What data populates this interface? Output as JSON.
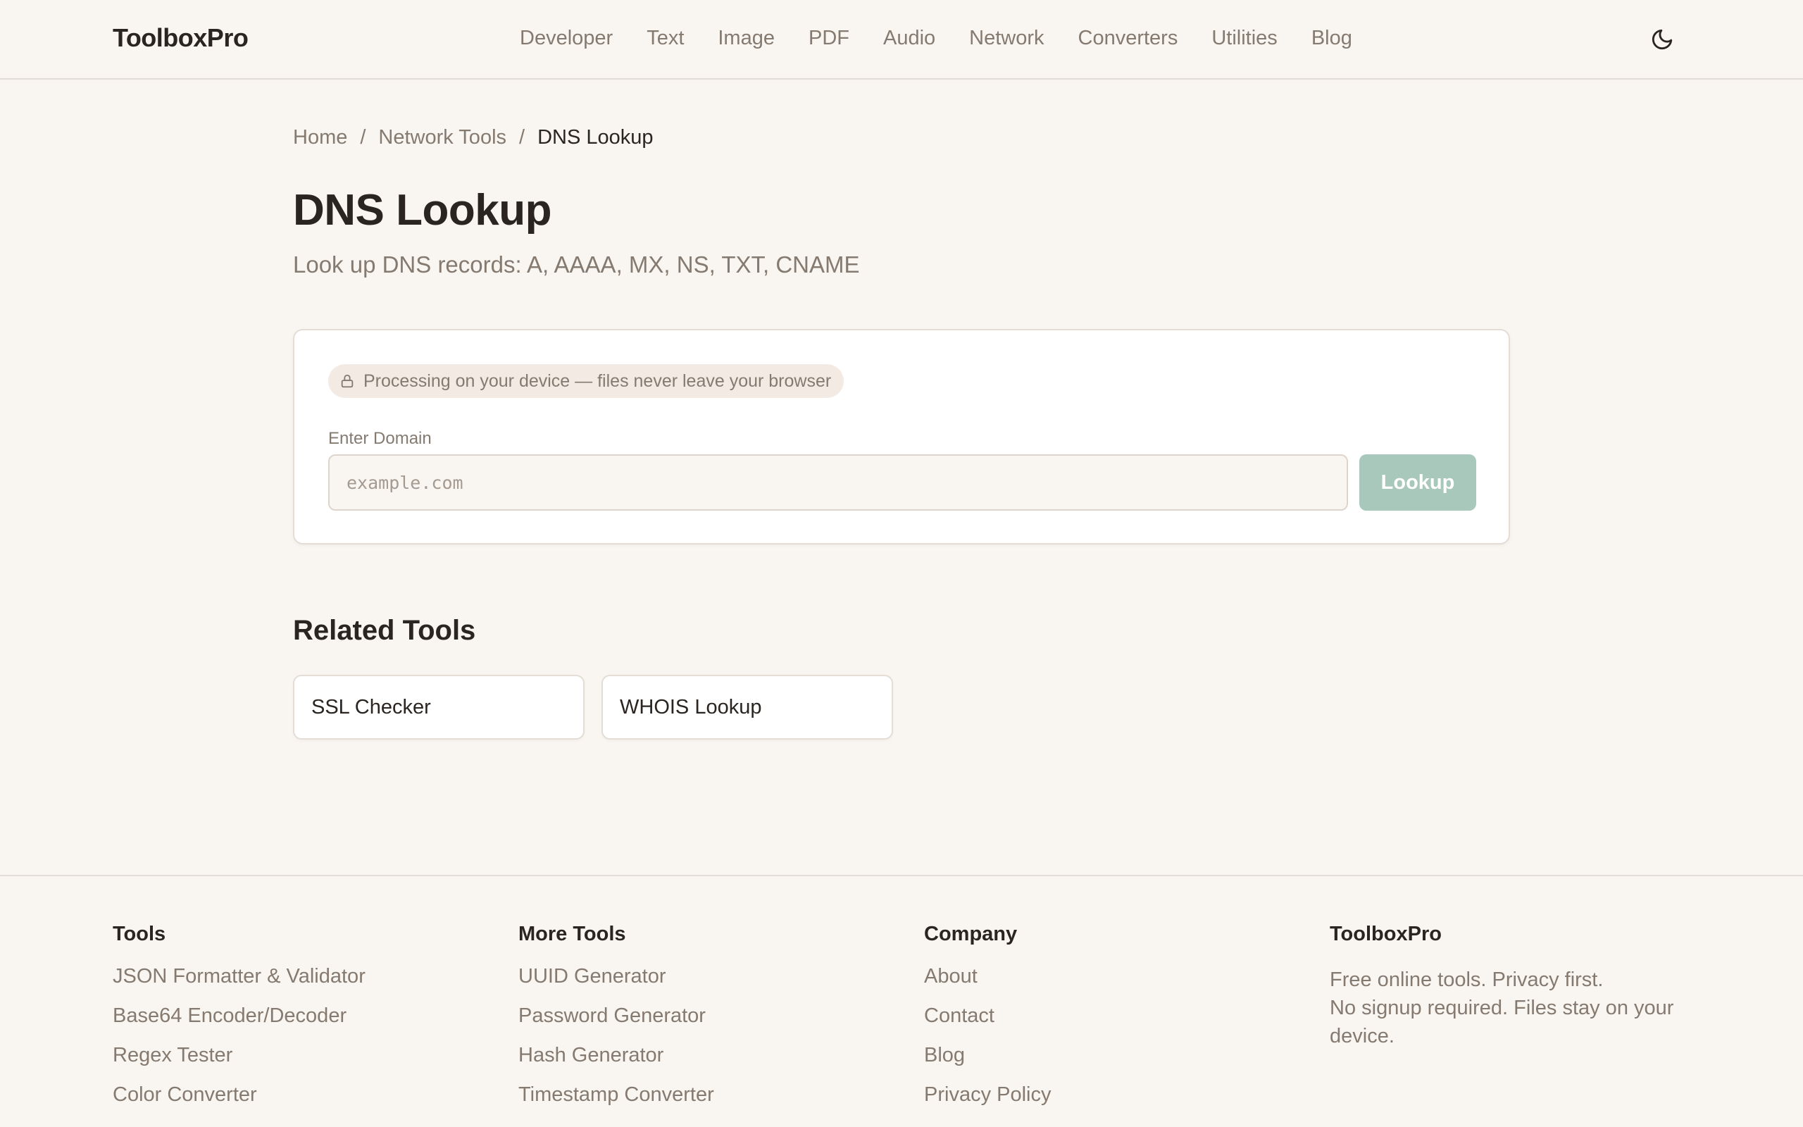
{
  "header": {
    "logo": "ToolboxPro",
    "nav": [
      "Developer",
      "Text",
      "Image",
      "PDF",
      "Audio",
      "Network",
      "Converters",
      "Utilities",
      "Blog"
    ],
    "theme_icon": "moon-icon"
  },
  "breadcrumb": {
    "home": "Home",
    "sep": "/",
    "section": "Network Tools",
    "current": "DNS Lookup"
  },
  "page": {
    "title": "DNS Lookup",
    "subtitle": "Look up DNS records: A, AAAA, MX, NS, TXT, CNAME"
  },
  "tool": {
    "privacy_badge": "Processing on your device — files never leave your browser",
    "privacy_icon": "lock-icon",
    "field_label": "Enter Domain",
    "input_value": "",
    "input_placeholder": "example.com",
    "button_label": "Lookup",
    "button_color": "#a8c8bb"
  },
  "related": {
    "title": "Related Tools",
    "items": [
      "SSL Checker",
      "WHOIS Lookup"
    ]
  },
  "footer": {
    "columns": [
      {
        "heading": "Tools",
        "links": [
          "JSON Formatter & Validator",
          "Base64 Encoder/Decoder",
          "Regex Tester",
          "Color Converter"
        ]
      },
      {
        "heading": "More Tools",
        "links": [
          "UUID Generator",
          "Password Generator",
          "Hash Generator",
          "Timestamp Converter"
        ]
      },
      {
        "heading": "Company",
        "links": [
          "About",
          "Contact",
          "Blog",
          "Privacy Policy"
        ]
      }
    ],
    "about": {
      "heading": "ToolboxPro",
      "line1": "Free online tools. Privacy first.",
      "line2": "No signup required. Files stay on your device."
    }
  }
}
